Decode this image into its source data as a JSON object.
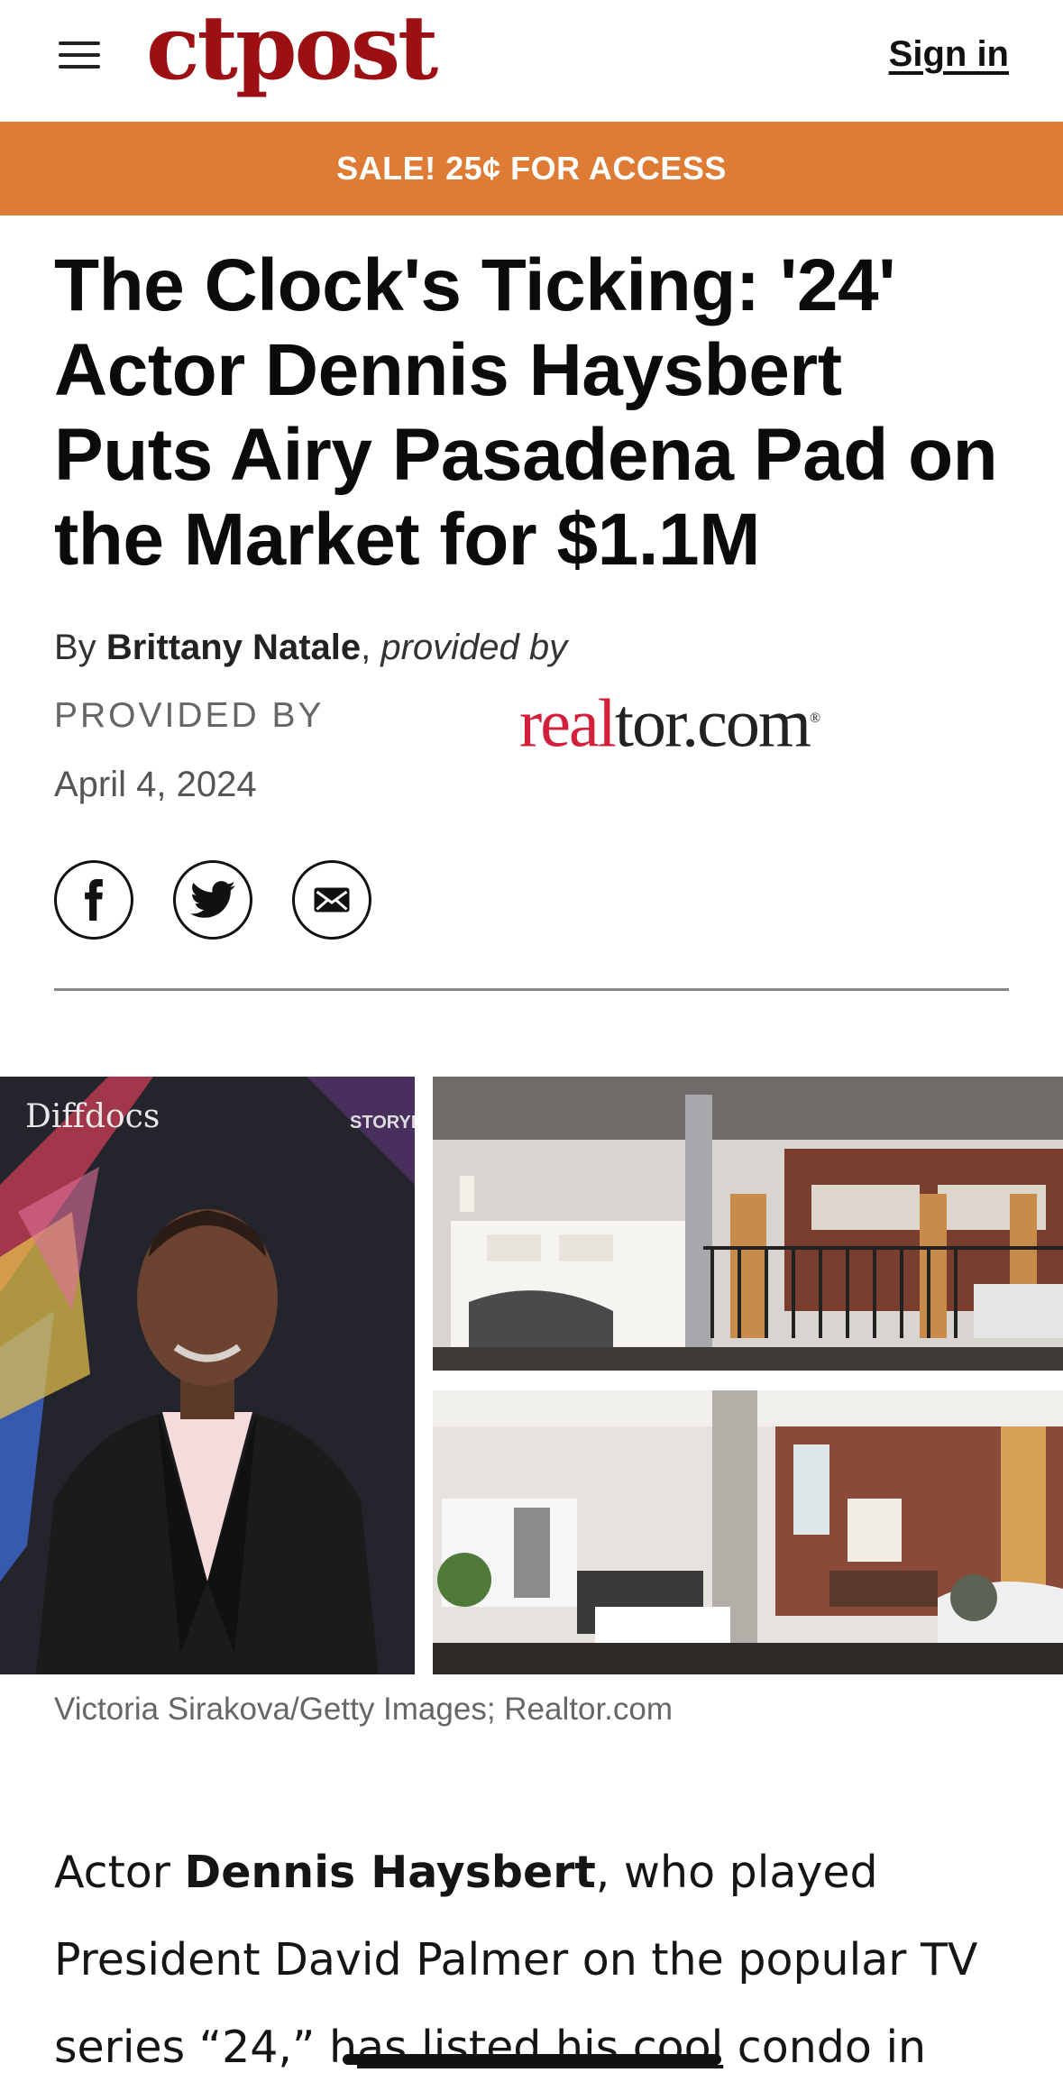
{
  "header": {
    "logo": "ctpost",
    "signin_label": "Sign in"
  },
  "sale_banner": {
    "text": "SALE! 25¢ FOR ACCESS"
  },
  "article": {
    "headline": "The Clock's Ticking: '24' Actor Dennis Haysbert Puts Airy Pasadena Pad on the Market for $1.1M",
    "byline_prefix": "By",
    "author": "Brittany Natale",
    "provided_by_inline": "provided by",
    "provided_by_label": "PROVIDED BY",
    "provider_logo": {
      "red": "real",
      "dark": "tor.com",
      "mark": "®"
    },
    "date": "April 4, 2024",
    "share_icons": [
      "facebook-icon",
      "twitter-icon",
      "email-icon"
    ],
    "photo_caption": "Victoria Sirakova/Getty Images; Realtor.com",
    "photo_left_backdrop_text": [
      "Diffdocs",
      "STORYL"
    ],
    "body": {
      "part1": "Actor ",
      "bold": "Dennis Haysbert",
      "part2": ", who played President David Palmer on the popular TV series “24,” h",
      "linked": "as listed his cool",
      "part3": " condo in"
    }
  },
  "colors": {
    "brand_red": "#9c1014",
    "sale_orange": "#de7b34",
    "realtor_red": "#d21f3c"
  }
}
